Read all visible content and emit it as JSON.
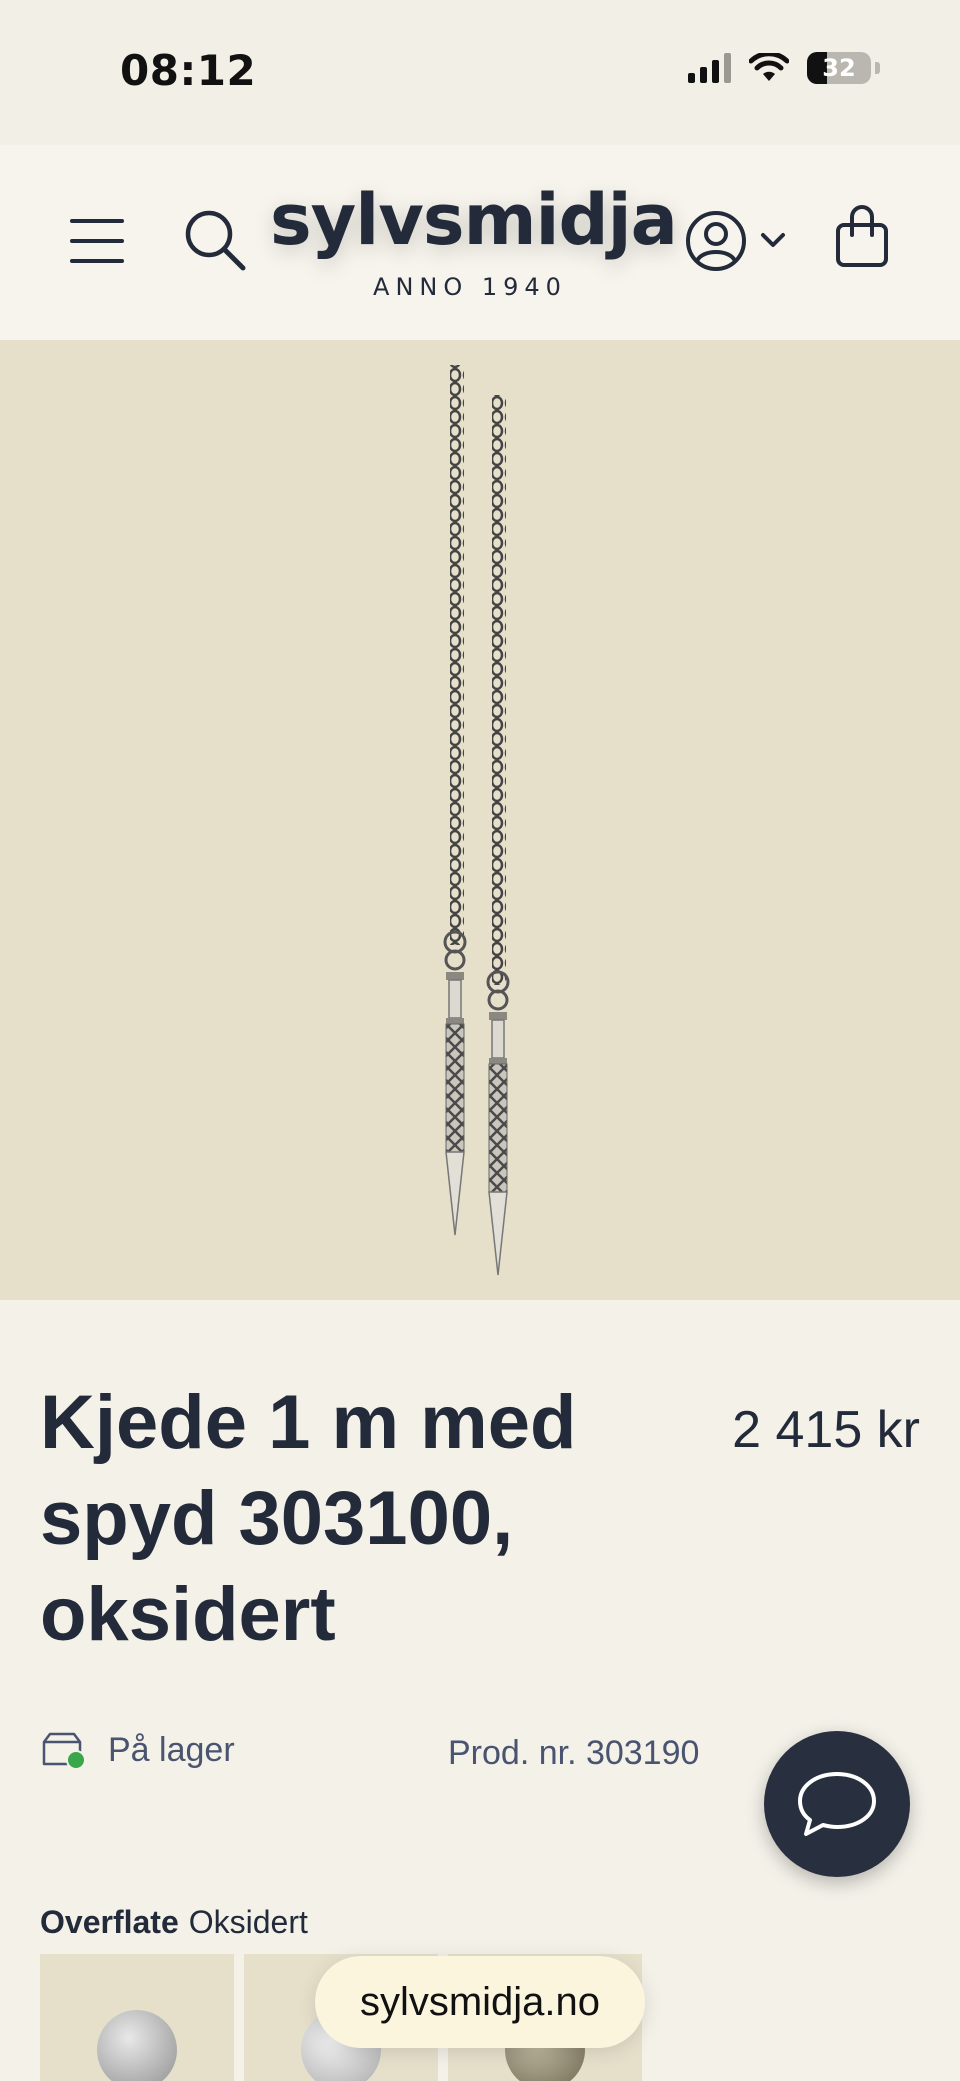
{
  "status_bar": {
    "time": "08:12",
    "battery": "32"
  },
  "header": {
    "logo_name": "sylvsmidja",
    "logo_sub": "ANNO 1940",
    "icons": [
      "menu-icon",
      "search-icon",
      "account-icon",
      "chevron-down-icon",
      "bag-icon"
    ]
  },
  "product": {
    "title": "Kjede 1 m med spyd 303100, oksidert",
    "price": "2 415 kr",
    "stock_status": "På lager",
    "product_number": "Prod. nr. 303190",
    "variant": {
      "label": "Overflate",
      "value": "Oksidert"
    }
  },
  "browser": {
    "url": "sylvsmidja.no"
  },
  "colors": {
    "brand_dark": "#232b3a",
    "image_bg": "#e6e0cb",
    "page_bg": "#f3f1e8",
    "stock_green": "#3aa64a"
  }
}
